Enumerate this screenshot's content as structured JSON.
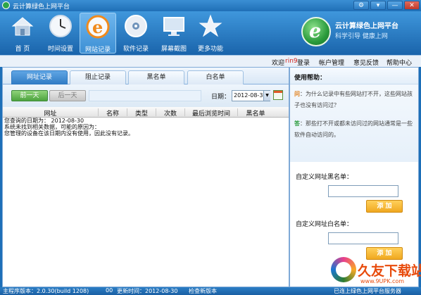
{
  "window": {
    "title": "云计算绿色上网平台",
    "buttons": [
      "⚙",
      "▾",
      "—",
      "✕"
    ]
  },
  "toolbar": {
    "items": [
      {
        "label": "首  页",
        "icon": "home-icon"
      },
      {
        "label": "时间设置",
        "icon": "clock-icon"
      },
      {
        "label": "网站记录",
        "icon": "browser-e-icon",
        "active": true
      },
      {
        "label": "软件记录",
        "icon": "disc-icon"
      },
      {
        "label": "屏幕截图",
        "icon": "monitor-icon"
      },
      {
        "label": "更多功能",
        "icon": "star-icon"
      }
    ]
  },
  "brand": {
    "name": "云计算绿色上网平台",
    "slogan": "科学引导  健康上网",
    "accent": "#2a9b3c"
  },
  "userbar": {
    "welcome": "欢迎",
    "username": "rin9",
    "login": "登录",
    "account": "帐户管理",
    "feedback": "意见反馈",
    "help_center": "帮助中心"
  },
  "tabs": [
    "网址记录",
    "阻止记录",
    "黑名单",
    "白名单"
  ],
  "filter": {
    "prev_day": "前一天",
    "next_day": "后一天",
    "date_label": "日期：",
    "date_value": "2012-08-30"
  },
  "table": {
    "columns": [
      "网址",
      "名称",
      "类型",
      "次数",
      "最后浏览时间",
      "黑名单"
    ]
  },
  "message": {
    "line1": "您查询的日期为： 2012-08-30",
    "line2": "系统未找到相关数据，可能的原因为：",
    "line3": "您管理的设备在该日期内没有使用，因此没有记录。"
  },
  "help": {
    "title": "使用帮助：",
    "q_key": "问",
    "question": "：为什么记录中有些网站打不开，这些网站孩子也没有访问过？",
    "a_key": "答",
    "answer": "：那些打不开或都未访问过的网站通常是一些软件自动访问的。",
    "blacklist_label": "自定义网址黑名单：",
    "whitelist_label": "自定义网址白名单：",
    "add_label": "添 加"
  },
  "status": {
    "version": "主程序版本：2.0.30(build 1208)",
    "zero": "00",
    "updated": "更新时间：2012-08-30",
    "check": "检查新版本",
    "connected": "已连上绿色上网平台服务器"
  },
  "watermark": {
    "text": "久友下载站",
    "url": "www.9UPK.com"
  }
}
